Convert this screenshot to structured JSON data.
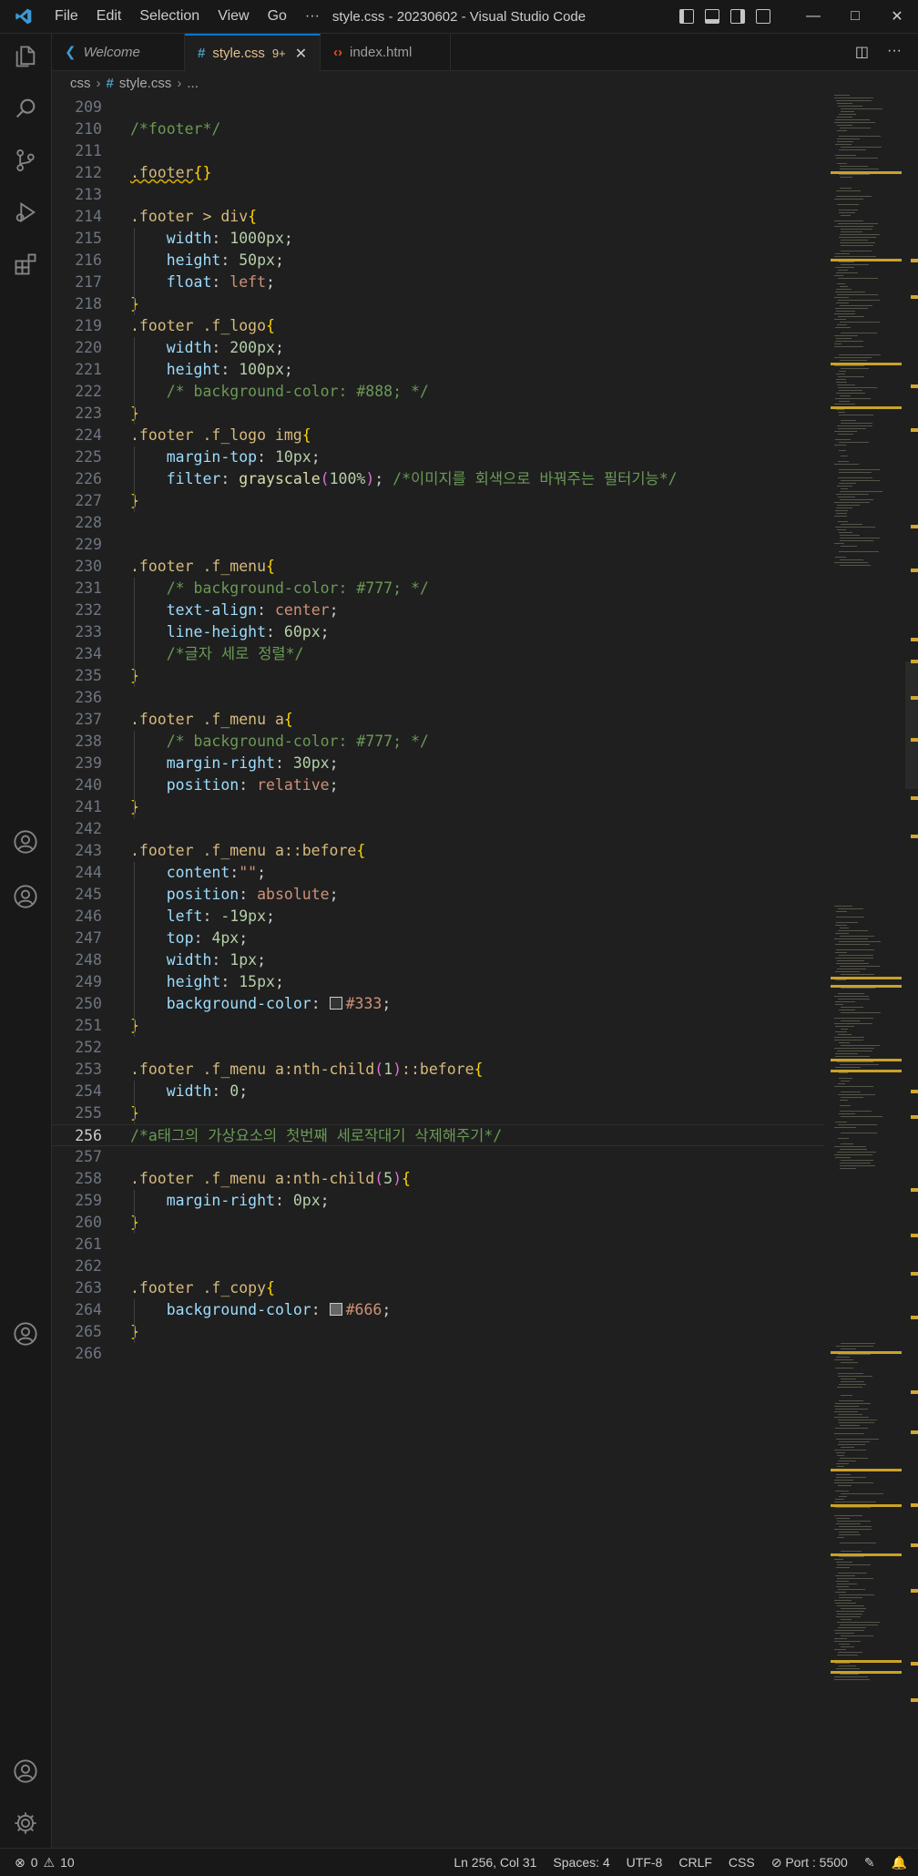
{
  "window": {
    "title": "style.css - 20230602 - Visual Studio Code",
    "menu": [
      "File",
      "Edit",
      "Selection",
      "View",
      "Go",
      "···"
    ],
    "controls": [
      "minimize",
      "maximize",
      "close"
    ]
  },
  "tabs": [
    {
      "label": "Welcome",
      "icon": "vscode-icon",
      "active": false
    },
    {
      "label": "style.css",
      "icon": "css-hash-icon",
      "badge": "9+",
      "active": true
    },
    {
      "label": "index.html",
      "icon": "html-icon",
      "active": false
    }
  ],
  "breadcrumb": {
    "folder": "css",
    "file": "style.css",
    "more": "..."
  },
  "editor": {
    "lines": [
      {
        "n": "209",
        "text": ""
      },
      {
        "n": "210",
        "text": "/*footer*/"
      },
      {
        "n": "211",
        "text": ""
      },
      {
        "n": "212",
        "text": ".footer{}"
      },
      {
        "n": "213",
        "text": ""
      },
      {
        "n": "214",
        "text": ".footer > div{"
      },
      {
        "n": "215",
        "text": "    width: 1000px;"
      },
      {
        "n": "216",
        "text": "    height: 50px;"
      },
      {
        "n": "217",
        "text": "    float: left;"
      },
      {
        "n": "218",
        "text": "}"
      },
      {
        "n": "219",
        "text": ".footer .f_logo{"
      },
      {
        "n": "220",
        "text": "    width: 200px;"
      },
      {
        "n": "221",
        "text": "    height: 100px;"
      },
      {
        "n": "222",
        "text": "    /* background-color: #888; */"
      },
      {
        "n": "223",
        "text": "}"
      },
      {
        "n": "224",
        "text": ".footer .f_logo img{"
      },
      {
        "n": "225",
        "text": "    margin-top: 10px;"
      },
      {
        "n": "226",
        "text": "    filter: grayscale(100%); /*이미지를 회색으로 바꿔주는 필터기능*/"
      },
      {
        "n": "227",
        "text": "}"
      },
      {
        "n": "228",
        "text": ""
      },
      {
        "n": "229",
        "text": ""
      },
      {
        "n": "230",
        "text": ".footer .f_menu{"
      },
      {
        "n": "231",
        "text": "    /* background-color: #777; */"
      },
      {
        "n": "232",
        "text": "    text-align: center;"
      },
      {
        "n": "233",
        "text": "    line-height: 60px;"
      },
      {
        "n": "234",
        "text": "    /*글자 세로 정렬*/"
      },
      {
        "n": "235",
        "text": "}"
      },
      {
        "n": "236",
        "text": ""
      },
      {
        "n": "237",
        "text": ".footer .f_menu a{"
      },
      {
        "n": "238",
        "text": "    /* background-color: #777; */"
      },
      {
        "n": "239",
        "text": "    margin-right: 30px;"
      },
      {
        "n": "240",
        "text": "    position: relative;"
      },
      {
        "n": "241",
        "text": "}"
      },
      {
        "n": "242",
        "text": ""
      },
      {
        "n": "243",
        "text": ".footer .f_menu a::before{"
      },
      {
        "n": "244",
        "text": "    content:\"\";"
      },
      {
        "n": "245",
        "text": "    position: absolute;"
      },
      {
        "n": "246",
        "text": "    left: -19px;"
      },
      {
        "n": "247",
        "text": "    top: 4px;"
      },
      {
        "n": "248",
        "text": "    width: 1px;"
      },
      {
        "n": "249",
        "text": "    height: 15px;"
      },
      {
        "n": "250",
        "text": "    background-color: #333;"
      },
      {
        "n": "251",
        "text": "}"
      },
      {
        "n": "252",
        "text": ""
      },
      {
        "n": "253",
        "text": ".footer .f_menu a:nth-child(1)::before{"
      },
      {
        "n": "254",
        "text": "    width: 0;"
      },
      {
        "n": "255",
        "text": "}"
      },
      {
        "n": "256",
        "text": "/*a태그의 가상요소의 첫번째 세로작대기 삭제해주기*/"
      },
      {
        "n": "257",
        "text": ""
      },
      {
        "n": "258",
        "text": ".footer .f_menu a:nth-child(5){"
      },
      {
        "n": "259",
        "text": "    margin-right: 0px;"
      },
      {
        "n": "260",
        "text": "}"
      },
      {
        "n": "261",
        "text": ""
      },
      {
        "n": "262",
        "text": ""
      },
      {
        "n": "263",
        "text": ".footer .f_copy{"
      },
      {
        "n": "264",
        "text": "    background-color: #666;"
      },
      {
        "n": "265",
        "text": "}"
      },
      {
        "n": "266",
        "text": ""
      }
    ],
    "current_line": "256"
  },
  "statusbar": {
    "errors": "0",
    "warnings": "10",
    "position": "Ln 256, Col 31",
    "spaces": "Spaces: 4",
    "encoding": "UTF-8",
    "eol": "CRLF",
    "language": "CSS",
    "port": "Port : 5500"
  },
  "colors": {
    "accent": "#0078d4",
    "selector": "#d7ba7d",
    "property": "#9cdcfe",
    "number": "#b5cea8",
    "value": "#ce9178",
    "comment": "#6a9955",
    "swatch_333": "#333333",
    "swatch_666": "#666666"
  }
}
